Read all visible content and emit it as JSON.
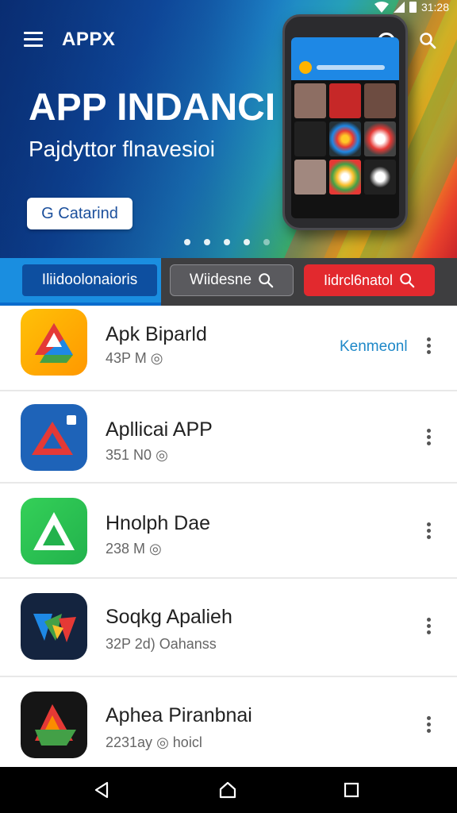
{
  "status_bar": {
    "time": "31:28"
  },
  "header": {
    "brand": "APPX"
  },
  "hero": {
    "title": "APP INDANCI",
    "subtitle": "Pajdyttor flnavesioi",
    "cta_label": "G Catarind"
  },
  "tabs": [
    {
      "label": "Iliidoolonaioris"
    },
    {
      "label": "Wiidesne"
    },
    {
      "label": "Iidrcl6natol"
    }
  ],
  "apps": [
    {
      "name": "Apk Biparld",
      "meta": "43P M",
      "action": "Kenmeonl"
    },
    {
      "name": "Apllicai APP",
      "meta": "351 N0"
    },
    {
      "name": "Hnolph Dae",
      "meta": "238 M"
    },
    {
      "name": "Soqkg Apalieh",
      "meta": "32P 2d) Oahanss"
    },
    {
      "name": "Aphea Piranbnai",
      "meta": "2231ay",
      "meta_suffix": "hoicl"
    }
  ],
  "colors": {
    "accent_blue": "#1a8ee0",
    "accent_red": "#e2292e",
    "action_text": "#1e88c8"
  },
  "icons": [
    "menu-icon",
    "search-icon",
    "wifi-icon",
    "signal-icon",
    "battery-icon",
    "more-vert-icon",
    "back-icon",
    "home-icon",
    "recents-icon"
  ]
}
